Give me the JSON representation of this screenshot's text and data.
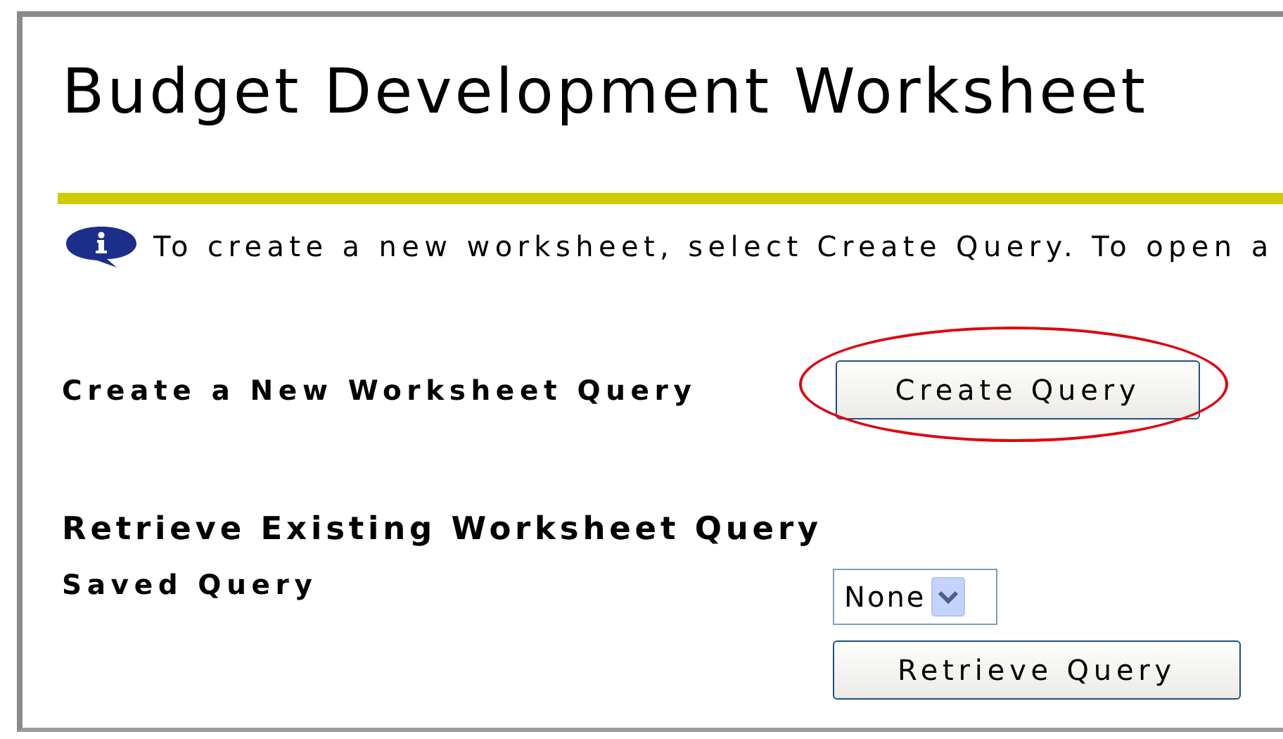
{
  "title": "Budget Development Worksheet",
  "info_message": "To create a new worksheet, select Create Query. To open a",
  "create_section": {
    "label": "Create a New Worksheet Query",
    "button": "Create Query",
    "highlighted": true
  },
  "retrieve_section": {
    "heading": "Retrieve Existing Worksheet Query",
    "field_label": "Saved Query",
    "select_value": "None",
    "button": "Retrieve Query"
  }
}
